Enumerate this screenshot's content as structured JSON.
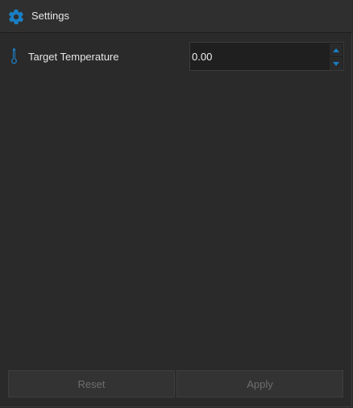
{
  "header": {
    "title": "Settings",
    "icon": "gear-icon"
  },
  "settings": {
    "rows": [
      {
        "icon": "thermometer-icon",
        "label": "Target Temperature",
        "value": "0.00"
      }
    ]
  },
  "footer": {
    "reset_label": "Reset",
    "apply_label": "Apply",
    "buttons_enabled": false
  },
  "colors": {
    "accent": "#1a7fc4",
    "background": "#2a2a2a",
    "header_background": "#2f2f2f",
    "disabled_text": "#6e6e6e"
  }
}
